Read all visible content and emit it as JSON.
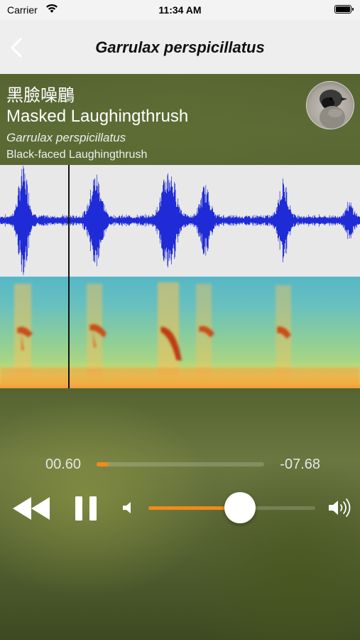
{
  "status_bar": {
    "carrier": "Carrier",
    "time": "11:34 AM"
  },
  "nav": {
    "title": "Garrulax perspicillatus",
    "back_icon": "chevron-left-icon"
  },
  "species": {
    "chinese_name": "黑臉噪鶥",
    "common_name": "Masked Laughingthrush",
    "scientific_name": "Garrulax perspicillatus",
    "alternate_name": "Black-faced Laughingthrush"
  },
  "audio": {
    "elapsed": "00.60",
    "remaining": "-07.68",
    "progress_fraction": 0.072,
    "playhead_fraction": 0.19,
    "volume_fraction": 0.55,
    "accent_color": "#f08a1c",
    "waveform_color": "#1f2bd6"
  },
  "controls": {
    "rewind_icon": "rewind-icon",
    "pause_icon": "pause-icon",
    "volume_low_icon": "volume-low-icon",
    "volume_high_icon": "volume-high-icon"
  }
}
